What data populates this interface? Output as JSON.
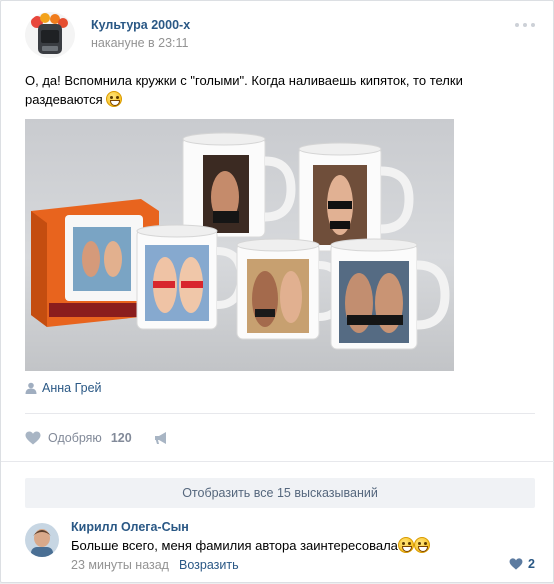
{
  "post": {
    "group_name": "Культура 2000-х",
    "time": "накануне в 23:11",
    "text": "О, да! Вспомнила кружки с \"голыми\". Когда наливаешь кипяток, то телки раздеваются",
    "text_emoji": "grinning-face-emoji",
    "photo_alt": "mugs-photo",
    "author_sign": "Анна Грей"
  },
  "actions": {
    "like_label": "Одобряю",
    "like_count": "120"
  },
  "comments": {
    "show_all_label": "Отобразить все 15 высказываний",
    "items": [
      {
        "author": "Кирилл Олега-Сын",
        "text": "Больше всего, меня фамилия автора заинтересовала",
        "time": "23 минуты назад",
        "reply_label": "Возразить",
        "likes": "2"
      }
    ]
  },
  "colors": {
    "link": "#2a5885",
    "muted": "#939393",
    "divider": "#e7e8ec",
    "button_bg": "#f0f2f5"
  }
}
